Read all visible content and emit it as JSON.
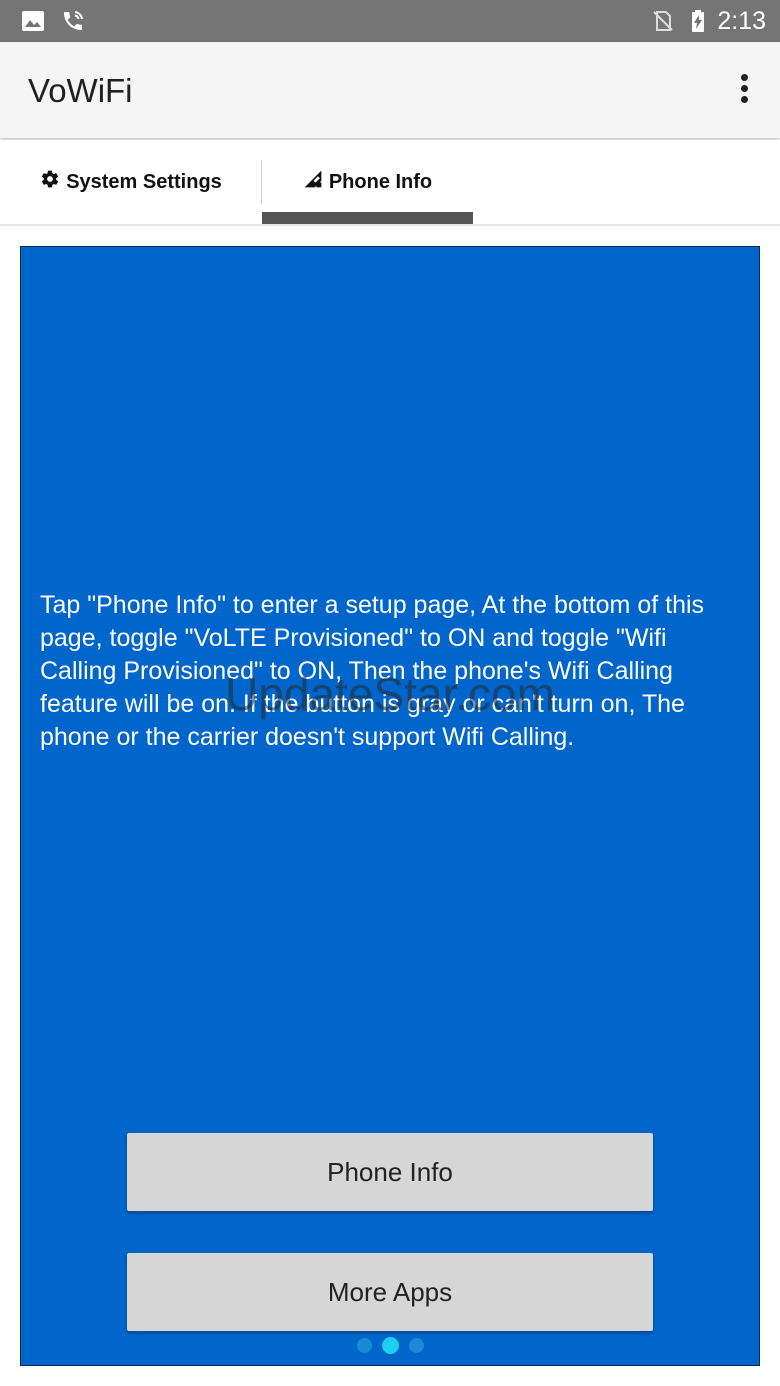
{
  "status_bar": {
    "time": "2:13",
    "icons": [
      "image-icon",
      "wifi-call-icon",
      "no-sim-icon",
      "battery-charging-icon"
    ]
  },
  "app_bar": {
    "title": "VoWiFi",
    "menu_icon": "more-vert-icon"
  },
  "tabs": [
    {
      "label": "System Settings",
      "icon": "gear-icon",
      "selected": false
    },
    {
      "label": "Phone Info",
      "icon": "signal-edit-icon",
      "selected": true
    }
  ],
  "content": {
    "background_color": "#0066cc",
    "intro_text": "Tap \"Phone Info\" to enter a setup page, At the bottom of this page, toggle \"VoLTE Provisioned\" to ON and toggle \"Wifi Calling Provisioned\" to ON, Then the phone's Wifi Calling feature will be on. If the button is gray or can't turn on,  The phone or the carrier doesn't support Wifi Calling.",
    "watermark": "UpdateStar.com",
    "buttons": {
      "phone_info": "Phone Info",
      "more_apps": "More Apps"
    },
    "pager": {
      "count": 3,
      "active_index": 1
    }
  },
  "colors": {
    "status_bar": "#757575",
    "accent_dot": "#1ed0f0",
    "tab_indicator": "#555555"
  }
}
